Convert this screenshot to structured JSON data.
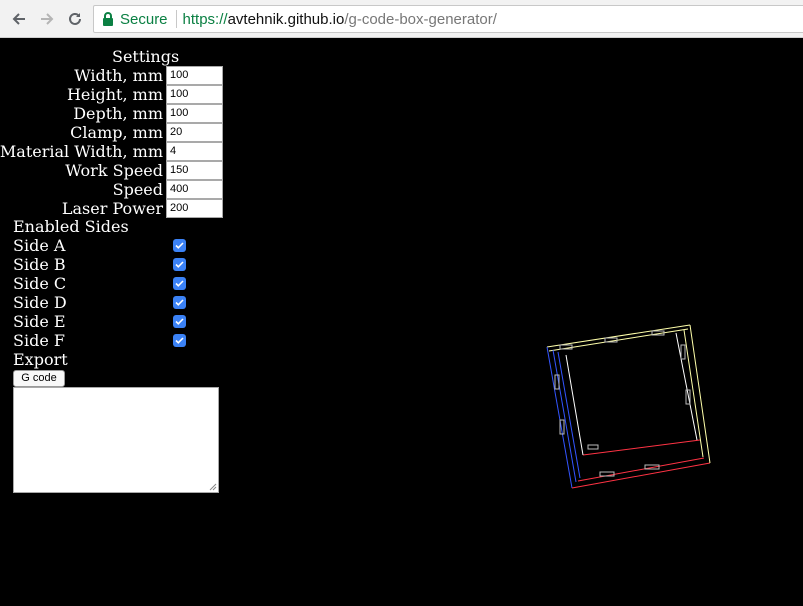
{
  "browser": {
    "secure_label": "Secure",
    "url_scheme": "https://",
    "url_host": "avtehnik.github.io",
    "url_path": "/g-code-box-generator/"
  },
  "settings": {
    "heading": "Settings",
    "width": {
      "label": "Width, mm",
      "value": "100"
    },
    "height": {
      "label": "Height, mm",
      "value": "100"
    },
    "depth": {
      "label": "Depth, mm",
      "value": "100"
    },
    "clamp": {
      "label": "Clamp, mm",
      "value": "20"
    },
    "material_width": {
      "label": "Material Width, mm",
      "value": "4"
    },
    "work_speed": {
      "label": "Work Speed",
      "value": "150"
    },
    "speed": {
      "label": "Speed",
      "value": "400"
    },
    "laser_power": {
      "label": "Laser Power",
      "value": "200"
    }
  },
  "sides": {
    "heading": "Enabled Sides",
    "items": [
      {
        "label": "Side A",
        "checked": true
      },
      {
        "label": "Side B",
        "checked": true
      },
      {
        "label": "Side C",
        "checked": true
      },
      {
        "label": "Side D",
        "checked": true
      },
      {
        "label": "Side E",
        "checked": true
      },
      {
        "label": "Side F",
        "checked": true
      }
    ]
  },
  "export": {
    "heading": "Export",
    "button_label": "G code",
    "output_value": ""
  },
  "colors": {
    "background": "#000000",
    "checkbox": "#3b82f6",
    "secure_green": "#0b8043",
    "edge_blue": "#3355ff",
    "edge_red": "#ff3344",
    "edge_yellow": "#ffffaa",
    "edge_white": "#ffffff"
  },
  "icons": [
    "back-arrow-icon",
    "forward-arrow-icon",
    "reload-icon",
    "lock-icon",
    "checkmark-icon",
    "resize-handle-icon"
  ]
}
